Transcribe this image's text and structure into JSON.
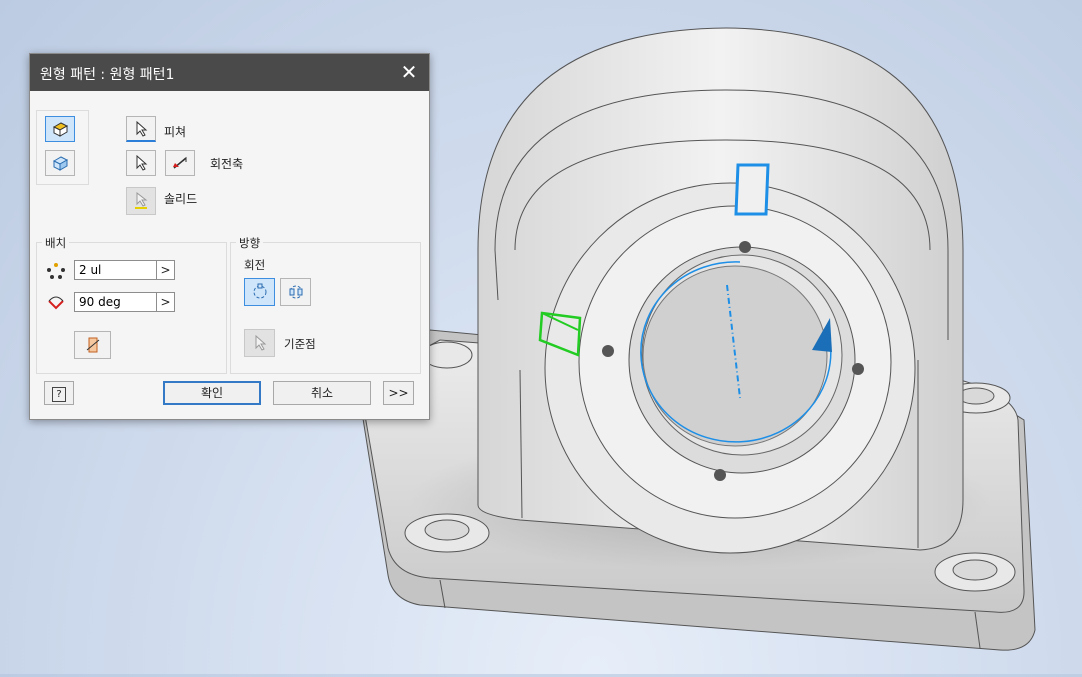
{
  "dialog": {
    "title": "원형 패턴 : 원형 패턴1",
    "close_glyph": "✕",
    "features_label": "피쳐",
    "axis_label": "회전축",
    "solid_label": "솔리드",
    "placement": {
      "section_label": "배치",
      "count_value": "2 ul",
      "angle_value": "90 deg",
      "arrow_glyph": ">"
    },
    "direction": {
      "section_label": "방향",
      "rotation_label": "회전",
      "base_point_label": "기준점"
    },
    "buttons": {
      "help": "?",
      "ok": "확인",
      "cancel": "취소",
      "more": ">>"
    }
  },
  "colors": {
    "titlebar": "#4a4a4a",
    "accent": "#3d8ee0",
    "selection_blue": "#1e8fe6",
    "selection_green": "#22cc22"
  },
  "icons": [
    "pattern-features-icon",
    "pattern-solids-icon",
    "select-arrow-icon",
    "flip-axis-icon",
    "count-icon",
    "angle-icon",
    "fitted-icon",
    "rotation-mode-icon",
    "fixed-mode-icon",
    "help-icon"
  ]
}
